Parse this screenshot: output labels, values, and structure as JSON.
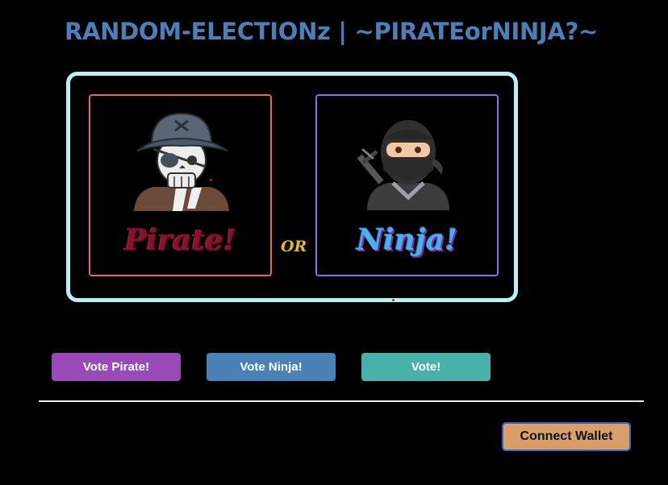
{
  "header": {
    "title": "RANDOM-ELECTIONz | ~PIRATEorNINJA?~"
  },
  "choices": {
    "pirate": {
      "label": "Pirate!",
      "icon": "pirate-skull-icon",
      "border_color": "#e8626c"
    },
    "separator": "OR",
    "ninja": {
      "label": "Ninja!",
      "icon": "ninja-icon",
      "border_color": "#8a6cf0"
    }
  },
  "actions": {
    "vote_pirate_label": "Vote Pirate!",
    "vote_ninja_label": "Vote Ninja!",
    "vote_label": "Vote!"
  },
  "wallet": {
    "connect_label": "Connect Wallet"
  },
  "colors": {
    "title": "#4a7fb8",
    "frame": "#b8f2f6",
    "vote_pirate": "#9a49b8",
    "vote_ninja": "#4a82b8",
    "vote": "#48b2aa",
    "connect_wallet": "#d8a068"
  }
}
